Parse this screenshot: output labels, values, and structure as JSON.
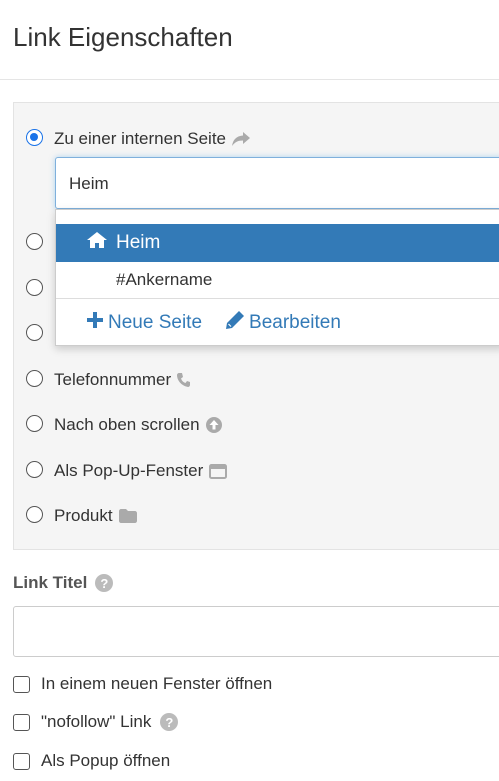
{
  "dialog": {
    "title": "Link Eigenschaften"
  },
  "link_types": [
    {
      "label": "Zu einer internen Seite",
      "selected": true,
      "icon": "share-icon"
    },
    {
      "label": "Telefonnummer",
      "selected": false,
      "icon": "phone-icon"
    },
    {
      "label": "Nach oben scrollen",
      "selected": false,
      "icon": "arrow-up-circle-icon"
    },
    {
      "label": "Als Pop-Up-Fenster",
      "selected": false,
      "icon": "window-icon"
    },
    {
      "label": "Produkt",
      "selected": false,
      "icon": "folder-icon"
    }
  ],
  "page_search": {
    "value": "Heim",
    "results": [
      {
        "label": "Heim",
        "icon": "home-icon",
        "active": true
      },
      {
        "label": "#Ankername",
        "active": false
      }
    ],
    "actions": {
      "new_page": "Neue Seite",
      "edit": "Bearbeiten"
    }
  },
  "link_title": {
    "label": "Link Titel",
    "value": ""
  },
  "options": [
    {
      "label": "In einem neuen Fenster öffnen",
      "checked": false
    },
    {
      "label": "\"nofollow\" Link",
      "checked": false,
      "help": true
    },
    {
      "label": "Als Popup öffnen",
      "checked": false
    }
  ],
  "colors": {
    "accent": "#337ab7",
    "radio": "#1a73e8",
    "panel_bg": "#f5f5f5"
  }
}
